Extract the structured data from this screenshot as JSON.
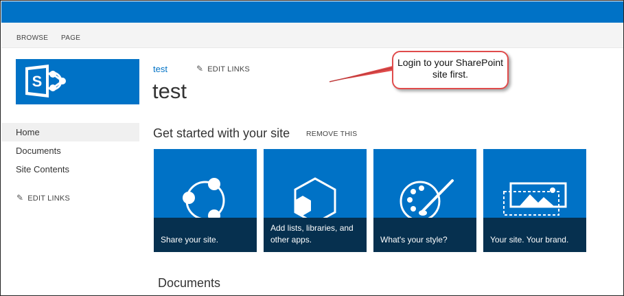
{
  "ribbon": {
    "tabs": [
      "BROWSE",
      "PAGE"
    ]
  },
  "logo": {
    "icon": "sharepoint-logo-icon",
    "color": "#0072c6"
  },
  "quick_launch": {
    "items": [
      {
        "label": "Home",
        "selected": true
      },
      {
        "label": "Documents",
        "selected": false
      },
      {
        "label": "Site Contents",
        "selected": false
      }
    ],
    "edit_links": "EDIT LINKS"
  },
  "header": {
    "breadcrumb": "test",
    "edit_links": "EDIT LINKS",
    "site_title": "test"
  },
  "get_started": {
    "title": "Get started with your site",
    "remove_label": "REMOVE THIS",
    "tiles": [
      {
        "caption": "Share your site.",
        "icon": "share-icon"
      },
      {
        "caption": "Add lists, libraries, and other apps.",
        "icon": "apps-icon"
      },
      {
        "caption": "What's your style?",
        "icon": "palette-icon"
      },
      {
        "caption": "Your site. Your brand.",
        "icon": "brand-image-icon"
      }
    ]
  },
  "documents_title": "Documents",
  "callout": {
    "text": "Login to your SharePoint site first."
  },
  "colors": {
    "suite_bar": "#0072c6",
    "tile": "#0072c6",
    "tile_caption": "#06304f",
    "callout_border": "#e04b4b"
  }
}
